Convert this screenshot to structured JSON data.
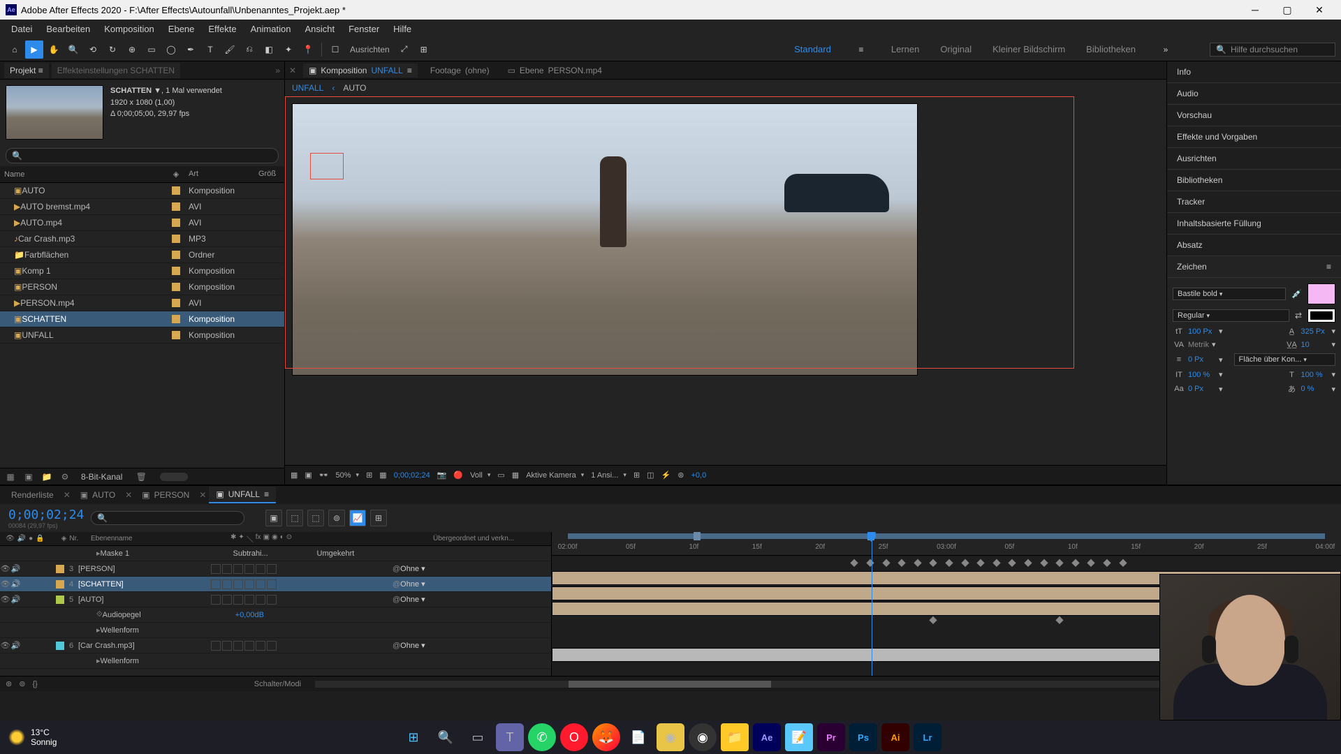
{
  "titlebar": {
    "app": "Adobe After Effects 2020",
    "path": "F:\\After Effects\\Autounfall\\Unbenanntes_Projekt.aep *"
  },
  "menu": [
    "Datei",
    "Bearbeiten",
    "Komposition",
    "Ebene",
    "Effekte",
    "Animation",
    "Ansicht",
    "Fenster",
    "Hilfe"
  ],
  "workspace": {
    "ausrichten": "Ausrichten",
    "tabs": [
      "Standard",
      "Lernen",
      "Original",
      "Kleiner Bildschirm",
      "Bibliotheken"
    ],
    "active": "Standard",
    "help_placeholder": "Hilfe durchsuchen"
  },
  "project": {
    "tab1": "Projekt",
    "tab2_label": "Effekteinstellungen",
    "tab2_comp": "SCHATTEN",
    "selected_meta": {
      "name": "SCHATTEN",
      "used": ", 1 Mal verwendet",
      "dim": "1920 x 1080 (1,00)",
      "dur": "Δ 0;00;05;00, 29,97 fps"
    },
    "cols": {
      "name": "Name",
      "art": "Art",
      "gross": "Größ"
    },
    "items": [
      {
        "name": "AUTO",
        "art": "Komposition",
        "color": "#d8a850",
        "icon": "comp"
      },
      {
        "name": "AUTO bremst.mp4",
        "art": "AVI",
        "color": "#d8a850",
        "icon": "video"
      },
      {
        "name": "AUTO.mp4",
        "art": "AVI",
        "color": "#d8a850",
        "icon": "video"
      },
      {
        "name": "Car Crash.mp3",
        "art": "MP3",
        "color": "#d8a850",
        "icon": "audio"
      },
      {
        "name": "Farbflächen",
        "art": "Ordner",
        "color": "#d8a850",
        "icon": "folder"
      },
      {
        "name": "Komp 1",
        "art": "Komposition",
        "color": "#d8a850",
        "icon": "comp"
      },
      {
        "name": "PERSON",
        "art": "Komposition",
        "color": "#d8a850",
        "icon": "comp"
      },
      {
        "name": "PERSON.mp4",
        "art": "AVI",
        "color": "#d8a850",
        "icon": "video"
      },
      {
        "name": "SCHATTEN",
        "art": "Komposition",
        "color": "#d8a850",
        "icon": "comp",
        "selected": true
      },
      {
        "name": "UNFALL",
        "art": "Komposition",
        "color": "#d8a850",
        "icon": "comp"
      }
    ],
    "footer_depth": "8-Bit-Kanal"
  },
  "comp_tabs": {
    "comp_label": "Komposition",
    "comp_name": "UNFALL",
    "footage_label": "Footage",
    "footage_name": "(ohne)",
    "layer_label": "Ebene",
    "layer_name": "PERSON.mp4"
  },
  "comp_crumbs": [
    "UNFALL",
    "AUTO"
  ],
  "comp_footer": {
    "zoom": "50%",
    "timecode": "0;00;02;24",
    "resolution": "Voll",
    "camera": "Aktive Kamera",
    "views": "1 Ansi...",
    "expo": "+0,0"
  },
  "right_panels": [
    "Info",
    "Audio",
    "Vorschau",
    "Effekte und Vorgaben",
    "Ausrichten",
    "Bibliotheken",
    "Tracker",
    "Inhaltsbasierte Füllung",
    "Absatz"
  ],
  "char_panel": {
    "title": "Zeichen",
    "font": "Bastile bold",
    "style": "Regular",
    "size": "100 Px",
    "leading": "325 Px",
    "kerning": "Metrik",
    "tracking": "10",
    "stroke": "0 Px",
    "stroke_mode": "Fläche über Kon...",
    "vscale": "100 %",
    "hscale": "100 %",
    "baseline": "0 Px",
    "tsume": "0 %"
  },
  "timeline": {
    "tabs": [
      {
        "name": "Renderliste"
      },
      {
        "name": "AUTO"
      },
      {
        "name": "PERSON"
      },
      {
        "name": "UNFALL",
        "active": true
      }
    ],
    "timecode": "0;00;02;24",
    "timecode_sub": "00084 (29,97 fps)",
    "cols": {
      "nr": "Nr.",
      "layer": "Ebenenname",
      "parent": "Übergeordnet und verkn..."
    },
    "rows": [
      {
        "indent": 2,
        "name": "Maske 1",
        "color": "#d8a850",
        "mode": "Subtrahi...",
        "inv": "Umgekehrt",
        "type": "mask"
      },
      {
        "num": "3",
        "name": "[PERSON]",
        "color": "#d8a850",
        "parent": "Ohne",
        "type": "comp"
      },
      {
        "num": "4",
        "name": "[SCHATTEN]",
        "color": "#d8a850",
        "parent": "Ohne",
        "type": "comp",
        "selected": true
      },
      {
        "num": "5",
        "name": "[AUTO]",
        "color": "#b0c84a",
        "parent": "Ohne",
        "type": "comp"
      },
      {
        "indent": 2,
        "name": "Audiopegel",
        "value": "+0,00dB",
        "type": "prop"
      },
      {
        "indent": 2,
        "name": "Wellenform",
        "type": "group"
      },
      {
        "num": "6",
        "name": "[Car Crash.mp3]",
        "color": "#50c8d8",
        "parent": "Ohne",
        "type": "audio"
      },
      {
        "indent": 2,
        "name": "Wellenform",
        "type": "group"
      }
    ],
    "ruler_ticks": [
      "02:00f",
      "05f",
      "10f",
      "15f",
      "20f",
      "25f",
      "03:00f",
      "05f",
      "10f",
      "15f",
      "20f",
      "25f",
      "04:00f"
    ],
    "footer_label": "Schalter/Modi"
  },
  "taskbar": {
    "temp": "13°C",
    "weather": "Sonnig",
    "apps": [
      "windows",
      "search",
      "tasks",
      "teams",
      "whatsapp",
      "opera",
      "firefox",
      "app",
      "discord",
      "spotify",
      "explorer",
      "ae",
      "notes",
      "pr",
      "ps",
      "ai",
      "lr"
    ]
  }
}
